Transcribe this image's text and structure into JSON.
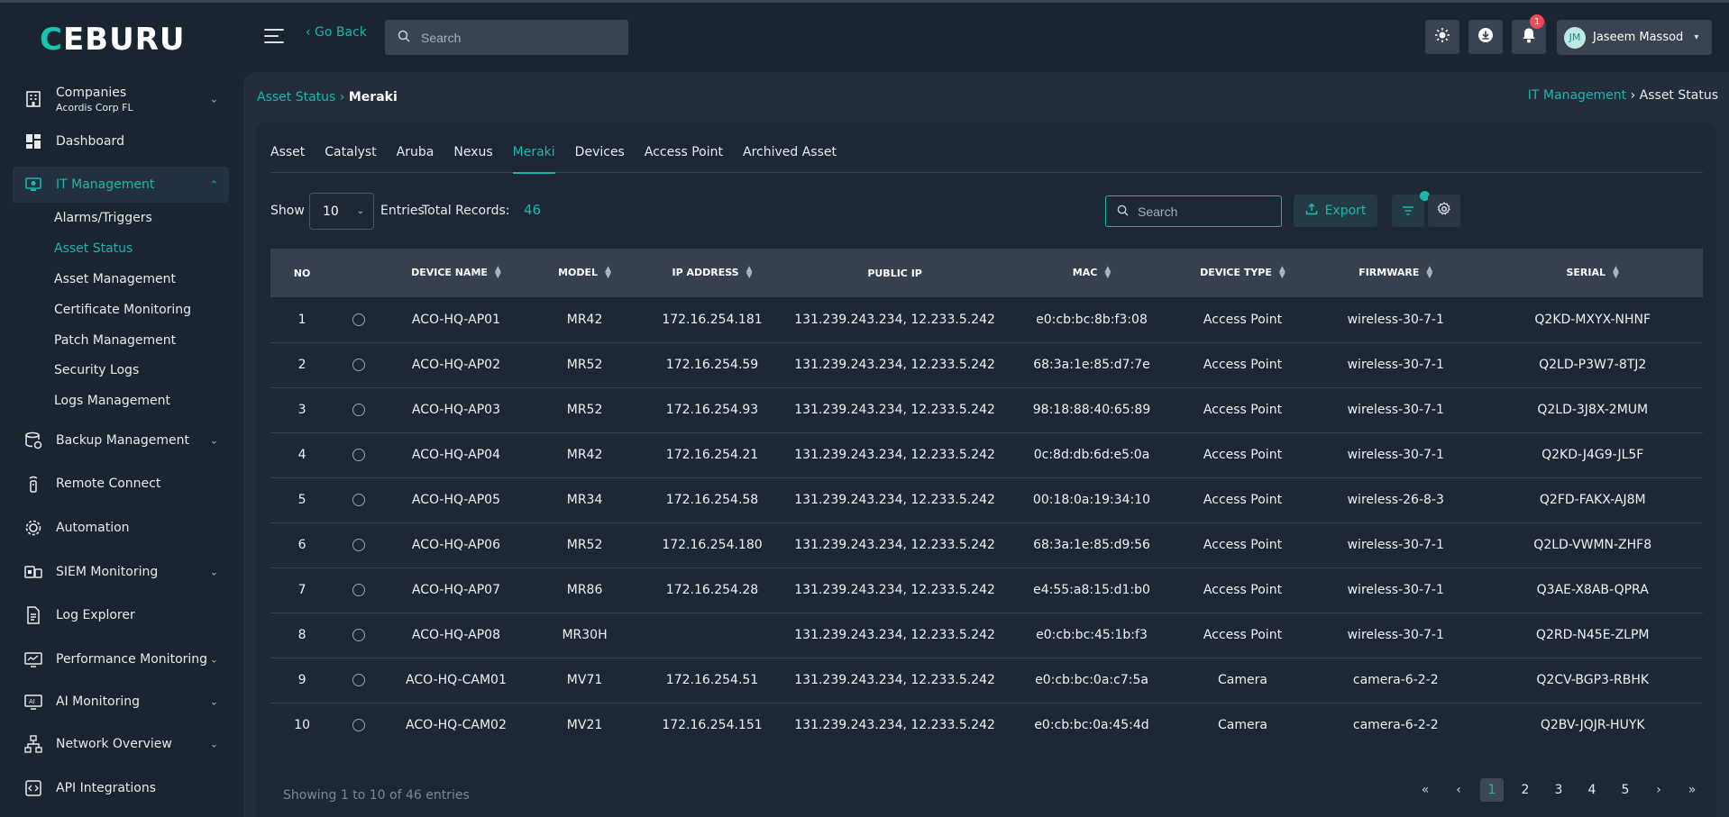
{
  "app": {
    "logo": "CEBURU",
    "logo_accent": "C"
  },
  "sidebar": {
    "company": {
      "label": "Companies",
      "sub": "Acordis Corp FL"
    },
    "items": [
      {
        "label": "Dashboard",
        "icon": "dashboard-icon"
      },
      {
        "label": "IT Management",
        "icon": "it-management-icon"
      },
      {
        "label": "Backup Management",
        "icon": "backup-icon"
      },
      {
        "label": "Remote Connect",
        "icon": "remote-icon"
      },
      {
        "label": "Automation",
        "icon": "automation-icon"
      },
      {
        "label": "SIEM Monitoring",
        "icon": "siem-icon"
      },
      {
        "label": "Log Explorer",
        "icon": "log-explorer-icon"
      },
      {
        "label": "Performance Monitoring",
        "icon": "performance-icon"
      },
      {
        "label": "AI Monitoring",
        "icon": "ai-icon"
      },
      {
        "label": "Network Overview",
        "icon": "network-icon"
      },
      {
        "label": "API Integrations",
        "icon": "api-icon"
      }
    ],
    "submenu": [
      "Alarms/Triggers",
      "Asset Status",
      "Asset Management",
      "Certificate Monitoring",
      "Patch Management",
      "Security Logs",
      "Logs Management"
    ]
  },
  "topbar": {
    "go_back": "‹ Go Back",
    "search_placeholder": "Search",
    "notification_count": "1",
    "user_initials": "JM",
    "user_name": "Jaseem Massod"
  },
  "breadcrumb": {
    "left_parent": "Asset Status",
    "left_current": "Meraki",
    "right_parent": "IT Management",
    "right_current": "Asset Status"
  },
  "tabs": [
    "Asset",
    "Catalyst",
    "Aruba",
    "Nexus",
    "Meraki",
    "Devices",
    "Access Point",
    "Archived Asset"
  ],
  "controls": {
    "show_label": "Show",
    "show_value": "10",
    "entries_label": "Entries",
    "total_label": "Total Records:",
    "total_value": "46",
    "search_placeholder": "Search",
    "export_label": "Export"
  },
  "table": {
    "headers": [
      "NO",
      "",
      "DEVICE NAME",
      "MODEL",
      "IP ADDRESS",
      "PUBLIC IP",
      "MAC",
      "DEVICE TYPE",
      "FIRMWARE",
      "SERIAL"
    ],
    "rows": [
      [
        "1",
        "ACO-HQ-AP01",
        "MR42",
        "172.16.254.181",
        "131.239.243.234, 12.233.5.242",
        "e0:cb:bc:8b:f3:08",
        "Access Point",
        "wireless-30-7-1",
        "Q2KD-MXYX-NHNF"
      ],
      [
        "2",
        "ACO-HQ-AP02",
        "MR52",
        "172.16.254.59",
        "131.239.243.234, 12.233.5.242",
        "68:3a:1e:85:d7:7e",
        "Access Point",
        "wireless-30-7-1",
        "Q2LD-P3W7-8TJ2"
      ],
      [
        "3",
        "ACO-HQ-AP03",
        "MR52",
        "172.16.254.93",
        "131.239.243.234, 12.233.5.242",
        "98:18:88:40:65:89",
        "Access Point",
        "wireless-30-7-1",
        "Q2LD-3J8X-2MUM"
      ],
      [
        "4",
        "ACO-HQ-AP04",
        "MR42",
        "172.16.254.21",
        "131.239.243.234, 12.233.5.242",
        "0c:8d:db:6d:e5:0a",
        "Access Point",
        "wireless-30-7-1",
        "Q2KD-J4G9-JL5F"
      ],
      [
        "5",
        "ACO-HQ-AP05",
        "MR34",
        "172.16.254.58",
        "131.239.243.234, 12.233.5.242",
        "00:18:0a:19:34:10",
        "Access Point",
        "wireless-26-8-3",
        "Q2FD-FAKX-AJ8M"
      ],
      [
        "6",
        "ACO-HQ-AP06",
        "MR52",
        "172.16.254.180",
        "131.239.243.234, 12.233.5.242",
        "68:3a:1e:85:d9:56",
        "Access Point",
        "wireless-30-7-1",
        "Q2LD-VWMN-ZHF8"
      ],
      [
        "7",
        "ACO-HQ-AP07",
        "MR86",
        "172.16.254.28",
        "131.239.243.234, 12.233.5.242",
        "e4:55:a8:15:d1:b0",
        "Access Point",
        "wireless-30-7-1",
        "Q3AE-X8AB-QPRA"
      ],
      [
        "8",
        "ACO-HQ-AP08",
        "MR30H",
        "",
        "131.239.243.234, 12.233.5.242",
        "e0:cb:bc:45:1b:f3",
        "Access Point",
        "wireless-30-7-1",
        "Q2RD-N45E-ZLPM"
      ],
      [
        "9",
        "ACO-HQ-CAM01",
        "MV71",
        "172.16.254.51",
        "131.239.243.234, 12.233.5.242",
        "e0:cb:bc:0a:c7:5a",
        "Camera",
        "camera-6-2-2",
        "Q2CV-BGP3-RBHK"
      ],
      [
        "10",
        "ACO-HQ-CAM02",
        "MV21",
        "172.16.254.151",
        "131.239.243.234, 12.233.5.242",
        "e0:cb:bc:0a:45:4d",
        "Camera",
        "camera-6-2-2",
        "Q2BV-JQJR-HUYK"
      ]
    ]
  },
  "pagination": {
    "showing": "Showing 1 to 10 of 46 entries",
    "pages": [
      "1",
      "2",
      "3",
      "4",
      "5"
    ],
    "current": "1"
  },
  "colors": {
    "accent": "#19b8aa",
    "background": "#1b2431",
    "card": "#1e2735",
    "header_row": "#36404f",
    "badge": "#ef4b57"
  }
}
